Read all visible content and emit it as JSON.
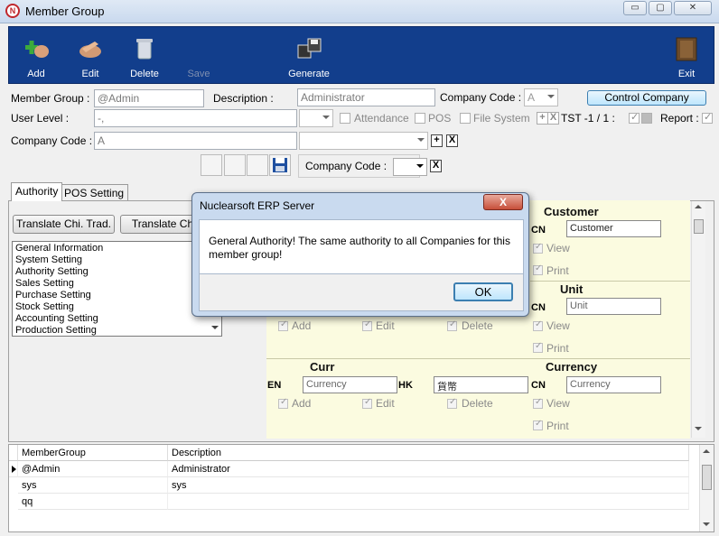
{
  "window": {
    "title": "Member Group",
    "minimize": "▭",
    "maximize": "▢",
    "close": "✕"
  },
  "toolbar": {
    "add": "Add",
    "edit": "Edit",
    "delete": "Delete",
    "save": "Save",
    "generate": "Generate",
    "exit": "Exit",
    "colors": {
      "background": "#123e8c"
    }
  },
  "form": {
    "member_group_label": "Member Group :",
    "member_group_value": "@Admin",
    "description_label": "Description :",
    "description_value": "Administrator",
    "company_code_label": "Company Code :",
    "company_code_value": "A",
    "control_company_button": "Control Company",
    "user_level_label": "User Level :",
    "user_level_value": "-,",
    "attendance_label": "Attendance",
    "pos_label": "POS",
    "file_system_label": "File System",
    "tst_label": "TST -1 / 1 :",
    "report_label": "Report :",
    "company_code2_label": "Company Code :",
    "company_code2_value": "A",
    "plus": "+",
    "x": "X"
  },
  "subbar": {
    "company_code_label": "Company Code :",
    "x": "X"
  },
  "tabs": {
    "authority": "Authority",
    "pos_setting": "POS Setting"
  },
  "buttons": {
    "translate_trad": "Translate Chi. Trad.",
    "translate_simp": "Translate Chi."
  },
  "settings_list": [
    "General Information",
    "System Setting",
    "Authority Setting",
    "Sales Setting",
    "Purchase Setting",
    "Stock Setting",
    "Accounting Setting",
    "Production Setting"
  ],
  "authority": {
    "customer_header": "Customer",
    "customer_cn_code": "CN",
    "customer_cn_value": "Customer",
    "unit_header": "Unit",
    "unit_cn_code": "CN",
    "unit_cn_value": "Unit",
    "curr_header": "Curr",
    "currency_header": "Currency",
    "en_code": "EN",
    "en_value": "Currency",
    "hk_code": "HK",
    "hk_value": "貨幣",
    "cn_code": "CN",
    "cn_value": "Currency",
    "view": "View",
    "print": "Print",
    "add": "Add",
    "edit": "Edit",
    "delete": "Delete"
  },
  "grid": {
    "columns": [
      "MemberGroup",
      "Description"
    ],
    "rows": [
      {
        "member_group": "@Admin",
        "description": "Administrator"
      },
      {
        "member_group": "sys",
        "description": "sys"
      },
      {
        "member_group": "qq",
        "description": ""
      }
    ]
  },
  "dialog": {
    "title": "Nuclearsoft ERP Server",
    "message": "General Authority! The same authority to all Companies for this member group!",
    "ok": "OK",
    "close": "X"
  },
  "icons": [
    "app-logo-icon",
    "add-user-icon",
    "edit-hand-icon",
    "delete-bin-icon",
    "save-disk-icon",
    "generate-disks-icon",
    "exit-door-icon"
  ]
}
